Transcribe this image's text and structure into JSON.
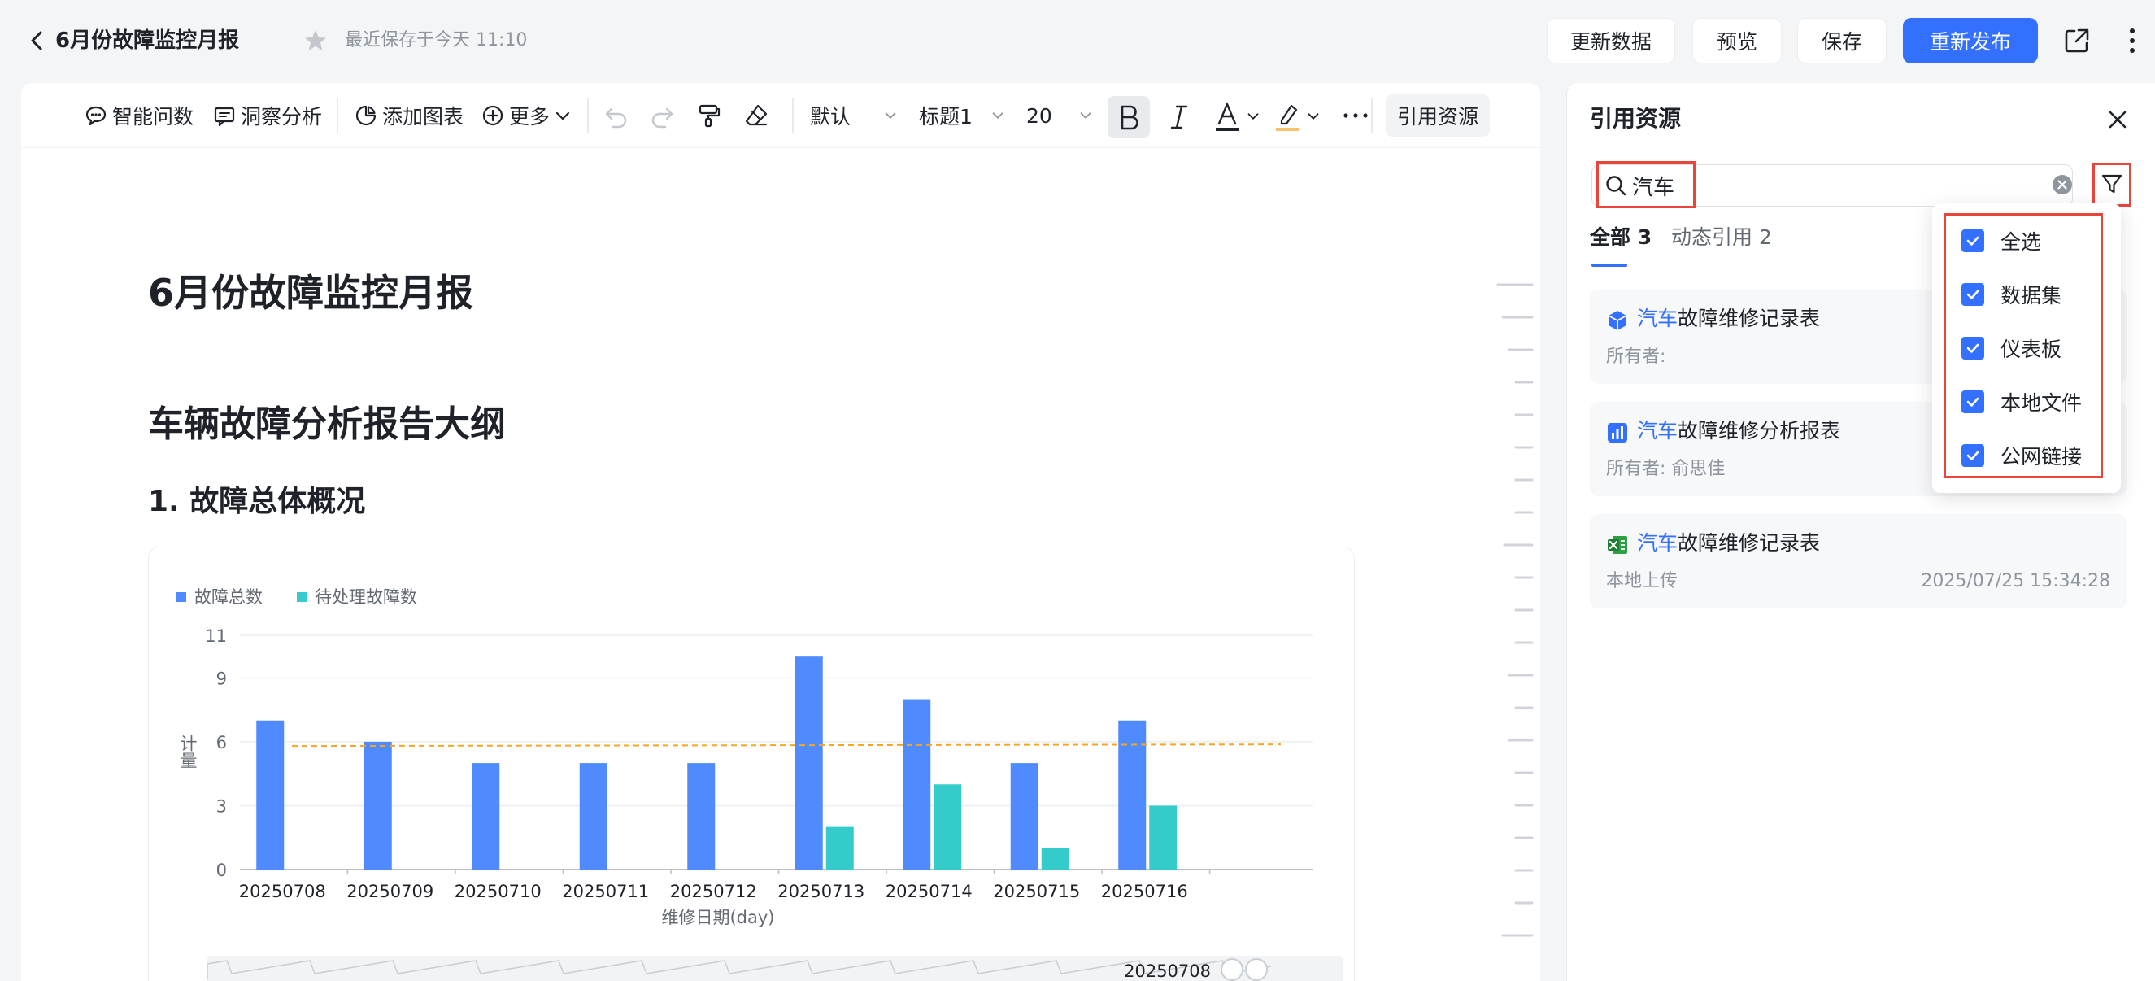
{
  "header": {
    "back_label": "",
    "title": "6月份故障监控月报",
    "save_status": "最近保存于今天 11:10",
    "buttons": {
      "refresh": "更新数据",
      "preview": "预览",
      "save": "保存",
      "publish": "重新发布"
    }
  },
  "toolbar": {
    "smart_qa": "智能问数",
    "insight": "洞察分析",
    "add_chart": "添加图表",
    "more": "更多",
    "font_style": "默认",
    "heading": "标题1",
    "font_size": "20",
    "ref_resource": "引用资源"
  },
  "document": {
    "title": "6月份故障监控月报",
    "outline_heading": "车辆故障分析报告大纲",
    "section_1": "1. 故障总体概况"
  },
  "chart_data": {
    "type": "bar",
    "categories": [
      "20250708",
      "20250709",
      "20250710",
      "20250711",
      "20250712",
      "20250713",
      "20250714",
      "20250715",
      "20250716"
    ],
    "series": [
      {
        "name": "故障总数",
        "values": [
          7,
          6,
          5,
          5,
          5,
          10,
          8,
          5,
          7
        ],
        "color": "#4f8bff"
      },
      {
        "name": "待处理故障数",
        "values": [
          0,
          0,
          0,
          0,
          0,
          2,
          4,
          1,
          3
        ],
        "color": "#36cbcb"
      }
    ],
    "average_line": 5.8,
    "average_color": "#f5a623",
    "ylabel": "计量",
    "xlabel": "维修日期(day)",
    "ylim": [
      0,
      11
    ],
    "yticks": [
      0,
      3,
      6,
      9,
      11
    ],
    "legend_position": "top-left",
    "slider_label": "20250708"
  },
  "right_panel": {
    "title": "引用资源",
    "search": {
      "value": "汽车",
      "placeholder": ""
    },
    "tabs": [
      {
        "label": "全部 3"
      },
      {
        "label": "动态引用 2"
      }
    ],
    "resources": [
      {
        "highlight": "汽车",
        "name_rest": "故障维修记录表",
        "owner": "所有者:",
        "time": "",
        "icon": "dataset-cube-icon"
      },
      {
        "highlight": "汽车",
        "name_rest": "故障维修分析报表",
        "owner": "所有者:  俞思佳",
        "time": "",
        "icon": "dashboard-chart-icon"
      },
      {
        "highlight": "汽车",
        "name_rest": "故障维修记录表",
        "owner": "本地上传",
        "time": "2025/07/25 15:34:28",
        "icon": "excel-file-icon"
      }
    ],
    "filter_menu": [
      {
        "label": "全选",
        "checked": true
      },
      {
        "label": "数据集",
        "checked": true
      },
      {
        "label": "仪表板",
        "checked": true
      },
      {
        "label": "本地文件",
        "checked": true
      },
      {
        "label": "公网链接",
        "checked": true
      }
    ]
  },
  "colors": {
    "accent": "#3370ff",
    "highlight_box": "#e8453c"
  }
}
